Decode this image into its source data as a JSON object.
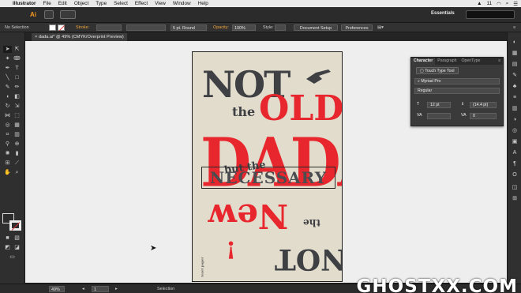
{
  "menubar": {
    "apple": "",
    "app": "Illustrator",
    "items": [
      "File",
      "Edit",
      "Object",
      "Type",
      "Select",
      "Effect",
      "View",
      "Window",
      "Help"
    ],
    "right_indicator": "11"
  },
  "appbar": {
    "logo": "Ai",
    "workspace": "Essentials"
  },
  "control": {
    "selection": "No Selection",
    "stroke_label": "Stroke:",
    "brush": "5 pt. Round",
    "opacity_label": "Opacity:",
    "opacity_value": "100%",
    "style_label": "Style:",
    "doc_setup": "Document Setup",
    "preferences": "Preferences"
  },
  "document": {
    "tab": "dada.ai* @ 49% (CMYK/Overprint Preview)"
  },
  "character_panel": {
    "tabs": [
      "Character",
      "Paragraph",
      "OpenType"
    ],
    "touch_tool": "Touch Type Tool",
    "font_family": "Myriad Pro",
    "font_style": "Regular",
    "size": "12 pt",
    "leading": "(14.4 pt)",
    "tracking": "0"
  },
  "artwork": {
    "not_top": "NOT",
    "the_top": "the",
    "old": "OLD",
    "dada": "DADA",
    "but_the": "but the",
    "necessary": "NECESSARY",
    "new": "New",
    "the_bottom": "the",
    "exclaim": "!",
    "not_bottom": "NOT",
    "credit": "tezet paper"
  },
  "status": {
    "zoom": "49%",
    "page": "1",
    "tool": "Selection"
  },
  "watermark": "GHOSTXX.COM",
  "colors": {
    "accent": "#f79820",
    "poster_red": "#e8262d",
    "poster_dark": "#3e4044",
    "paper": "#e2dccd"
  }
}
